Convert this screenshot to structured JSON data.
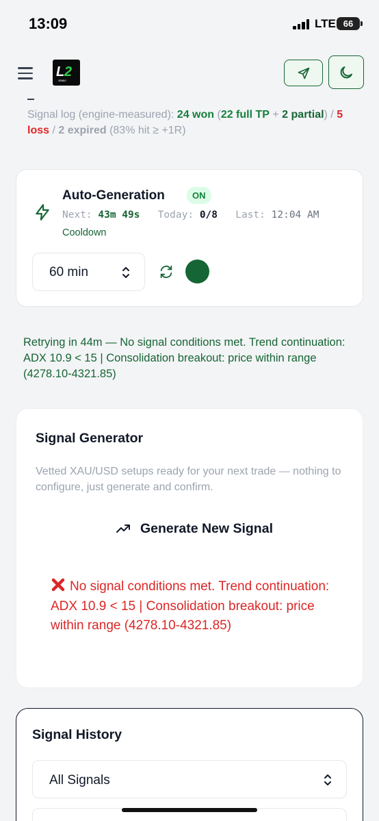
{
  "status_bar": {
    "time": "13:09",
    "network": "LTE",
    "battery": "66"
  },
  "header": {
    "logo_text": "L2",
    "logo_sub": "SIGNALS"
  },
  "signal_log": {
    "prefix": "Signal log (engine-measured): ",
    "won": "24 won",
    "open_paren": " (",
    "full_tp": "22 full TP",
    "plus": " + ",
    "partial": "2 partial",
    "close_paren": ") / ",
    "loss": "5 loss",
    "slash": " / ",
    "expired": "2 expired",
    "hit_rate": " (83% hit ≥ +1R)"
  },
  "auto_generation": {
    "title": "Auto-Generation",
    "status_badge": "ON",
    "next_label": "Next:",
    "next_value": "43m 49s",
    "today_label": "Today:",
    "today_value": "0/8",
    "last_label": "Last:",
    "last_value": "12:04 AM",
    "state": "Cooldown",
    "interval": "60 min"
  },
  "retry_message": "Retrying in 44m — No signal conditions met. Trend continuation: ADX 10.9 < 15 | Consolidation breakout: price within range (4278.10-4321.85)",
  "signal_generator": {
    "title": "Signal Generator",
    "description": "Vetted XAU/USD setups ready for your next trade — nothing to configure, just generate and confirm.",
    "button_label": "Generate New Signal",
    "error_message": "No signal conditions met. Trend continuation: ADX 10.9 < 15 | Consolidation breakout: price within range (4278.10-4321.85)"
  },
  "signal_history": {
    "title": "Signal History",
    "filter_value": "All Signals"
  },
  "colors": {
    "accent_green": "#166534",
    "win_green": "#15803d",
    "loss_red": "#dc2626",
    "muted": "#9ca3af"
  },
  "icons": [
    "hamburger-icon",
    "send-icon",
    "moon-icon",
    "bolt-icon",
    "chevron-updown-icon",
    "refresh-icon",
    "trend-up-icon",
    "x-icon"
  ]
}
